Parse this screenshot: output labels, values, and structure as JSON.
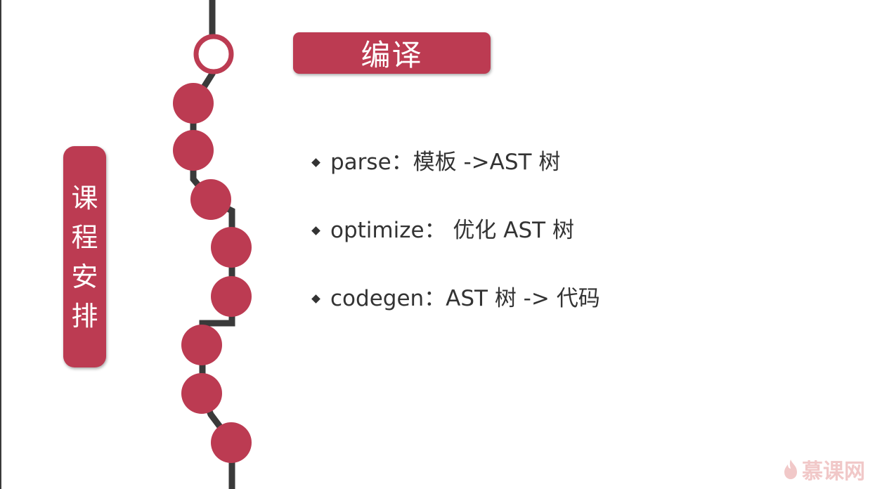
{
  "section_tag": "课程安排",
  "title": "编译",
  "bullets": [
    "parse：模板 ->AST 树",
    "optimize： 优化 AST 树",
    "codegen：AST 树 -> 代码"
  ],
  "watermark": {
    "text": "慕课网",
    "icon": "flame-logo-icon"
  },
  "colors": {
    "accent": "#bc3b52",
    "line": "#3a3a3a",
    "text": "#333333",
    "watermark": "#f1c8c8"
  }
}
